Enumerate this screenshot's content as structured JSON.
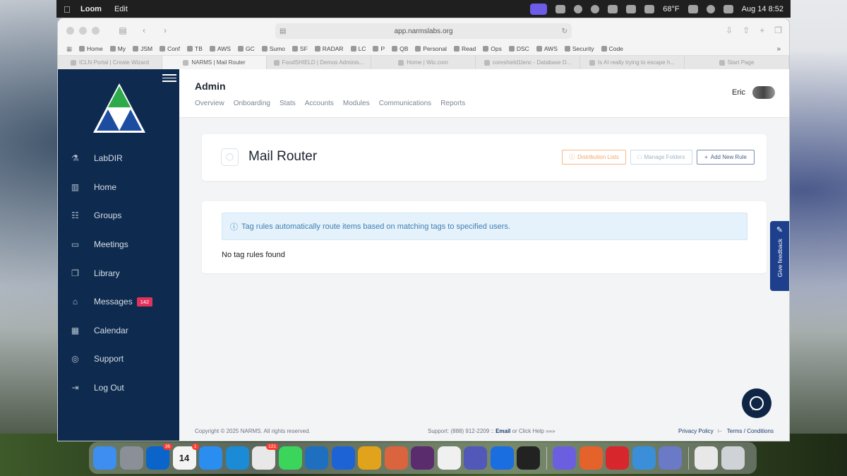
{
  "menubar": {
    "app": "Loom",
    "edit": "Edit",
    "weather": "68°F",
    "datetime": "Aug 14  8:52"
  },
  "browser": {
    "url": "app.narmslabs.org",
    "favorites": [
      "Home",
      "My",
      "JSM",
      "Conf",
      "TB",
      "AWS",
      "GC",
      "Sumo",
      "SF",
      "RADAR",
      "LC",
      "P",
      "QB",
      "Personal",
      "Read",
      "Ops",
      "DSC",
      "AWS",
      "Security",
      "Code"
    ],
    "tabs": [
      {
        "label": "ICLN Portal | Create Wizard",
        "active": false
      },
      {
        "label": "NARMS | Mail Router",
        "active": true
      },
      {
        "label": "FoodSHIELD | Demos Adminis...",
        "active": false
      },
      {
        "label": "Home | Wix.com",
        "active": false
      },
      {
        "label": "coreshield1lenc - Database D...",
        "active": false
      },
      {
        "label": "Is AI really trying to escape h...",
        "active": false
      },
      {
        "label": "Start Page",
        "active": false
      }
    ]
  },
  "sidebar": {
    "items": [
      {
        "label": "LabDIR",
        "icon": "flask-icon"
      },
      {
        "label": "Home",
        "icon": "book-icon"
      },
      {
        "label": "Groups",
        "icon": "users-icon"
      },
      {
        "label": "Meetings",
        "icon": "monitor-icon"
      },
      {
        "label": "Library",
        "icon": "copy-icon"
      },
      {
        "label": "Messages",
        "icon": "inbox-icon",
        "badge": "142"
      },
      {
        "label": "Calendar",
        "icon": "calendar-icon"
      },
      {
        "label": "Support",
        "icon": "lifebuoy-icon"
      },
      {
        "label": "Log Out",
        "icon": "logout-icon"
      }
    ]
  },
  "header": {
    "title": "Admin",
    "nav": [
      "Overview",
      "Onboarding",
      "Stats",
      "Accounts",
      "Modules",
      "Communications",
      "Reports"
    ],
    "user": "Eric"
  },
  "mailrouter": {
    "title": "Mail Router",
    "btn_distribution": "Distribution Lists",
    "btn_folders": "Manage Folders",
    "btn_add": "Add New Rule",
    "info": "Tag rules automatically route items based on matching tags to specified users.",
    "empty": "No tag rules found"
  },
  "feedback": "Give feedback",
  "footer": {
    "copyright": "Copyright © 2025 NARMS. All rights reserved.",
    "support_prefix": "Support: (888) 912-2209 :: ",
    "support_email": "Email",
    "support_suffix": " or Click Help »»»",
    "privacy": "Privacy Policy",
    "terms": "Terms / Conditions"
  },
  "dock": {
    "apps": [
      {
        "name": "finder",
        "color": "#3d8ef0"
      },
      {
        "name": "launchpad",
        "color": "#8a8f98"
      },
      {
        "name": "outlook",
        "color": "#0a64c9",
        "badge": "36"
      },
      {
        "name": "calendar",
        "color": "#f4f4f4",
        "label": "14",
        "badge": "1"
      },
      {
        "name": "safari",
        "color": "#2a8ef1"
      },
      {
        "name": "edge",
        "color": "#1b8bd6"
      },
      {
        "name": "slack",
        "color": "#e8e8e8",
        "badge": "121"
      },
      {
        "name": "messages",
        "color": "#3bd55b"
      },
      {
        "name": "vscode",
        "color": "#1f6fc0"
      },
      {
        "name": "maps",
        "color": "#1e63d6"
      },
      {
        "name": "navicat",
        "color": "#e0a31b"
      },
      {
        "name": "claude",
        "color": "#d9643e"
      },
      {
        "name": "notes-app",
        "color": "#5a2b6d"
      },
      {
        "name": "chatgpt",
        "color": "#f0f0f0"
      },
      {
        "name": "teams",
        "color": "#5258b8"
      },
      {
        "name": "1password",
        "color": "#1a6ee0"
      },
      {
        "name": "terminal",
        "color": "#222222"
      },
      {
        "name": "perplexity",
        "color": "#6b5fe0"
      },
      {
        "name": "firefox",
        "color": "#e5622a"
      },
      {
        "name": "pdf-reader",
        "color": "#d8262d"
      },
      {
        "name": "scrivener",
        "color": "#3a8fd8"
      },
      {
        "name": "archive-utility",
        "color": "#6a7ac7"
      },
      {
        "name": "documents",
        "color": "#e8e8e8"
      },
      {
        "name": "trash",
        "color": "#cfd3d8"
      }
    ]
  },
  "colors": {
    "sidebar": "#0e2b4f",
    "accent": "#1e3f8c",
    "badge": "#e2325b",
    "info_bg": "#e5f2fb"
  }
}
